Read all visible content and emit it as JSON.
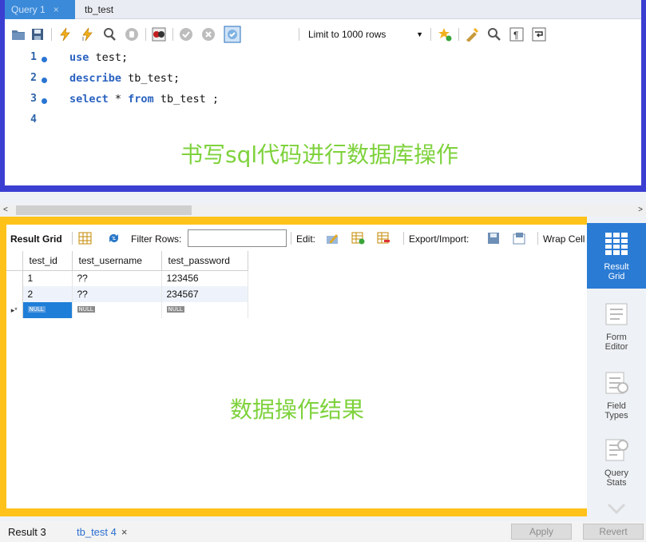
{
  "editor": {
    "tabs": [
      {
        "label": "Query 1",
        "close": "×"
      },
      {
        "label": "tb_test"
      }
    ],
    "limit_select": "Limit to 1000 rows",
    "lines": [
      {
        "num": "1",
        "kw": "use",
        "rest": " test;"
      },
      {
        "num": "2",
        "kw": "describe",
        "rest": " tb_test;"
      },
      {
        "num": "3",
        "kw": "select",
        "rest": " * ",
        "kw2": "from",
        "rest2": " tb_test ;"
      },
      {
        "num": "4"
      }
    ],
    "annotation": "书写sql代码进行数据库操作"
  },
  "result": {
    "toolbar": {
      "result_grid": "Result Grid",
      "filter_rows": "Filter Rows:",
      "edit": "Edit:",
      "export_import": "Export/Import:",
      "wrap_cell": "Wrap Cell"
    },
    "columns": [
      "test_id",
      "test_username",
      "test_password"
    ],
    "rows": [
      [
        "1",
        "??",
        "123456"
      ],
      [
        "2",
        "??",
        "234567"
      ]
    ],
    "null_label": "NULL",
    "new_row_marker": "▸*",
    "annotation": "数据操作结果"
  },
  "side_panel": {
    "items": [
      {
        "line1": "Result",
        "line2": "Grid"
      },
      {
        "line1": "Form",
        "line2": "Editor"
      },
      {
        "line1": "Field",
        "line2": "Types"
      },
      {
        "line1": "Query",
        "line2": "Stats"
      }
    ]
  },
  "bottom": {
    "tabs": [
      {
        "label": "Result 3"
      },
      {
        "label": "tb_test 4",
        "close": "×"
      }
    ],
    "apply": "Apply",
    "revert": "Revert"
  },
  "colors": {
    "editor_frame": "#3b3fd1",
    "result_frame": "#ffc21a",
    "annotation": "#7ed23c",
    "accent": "#2a7bd4"
  }
}
